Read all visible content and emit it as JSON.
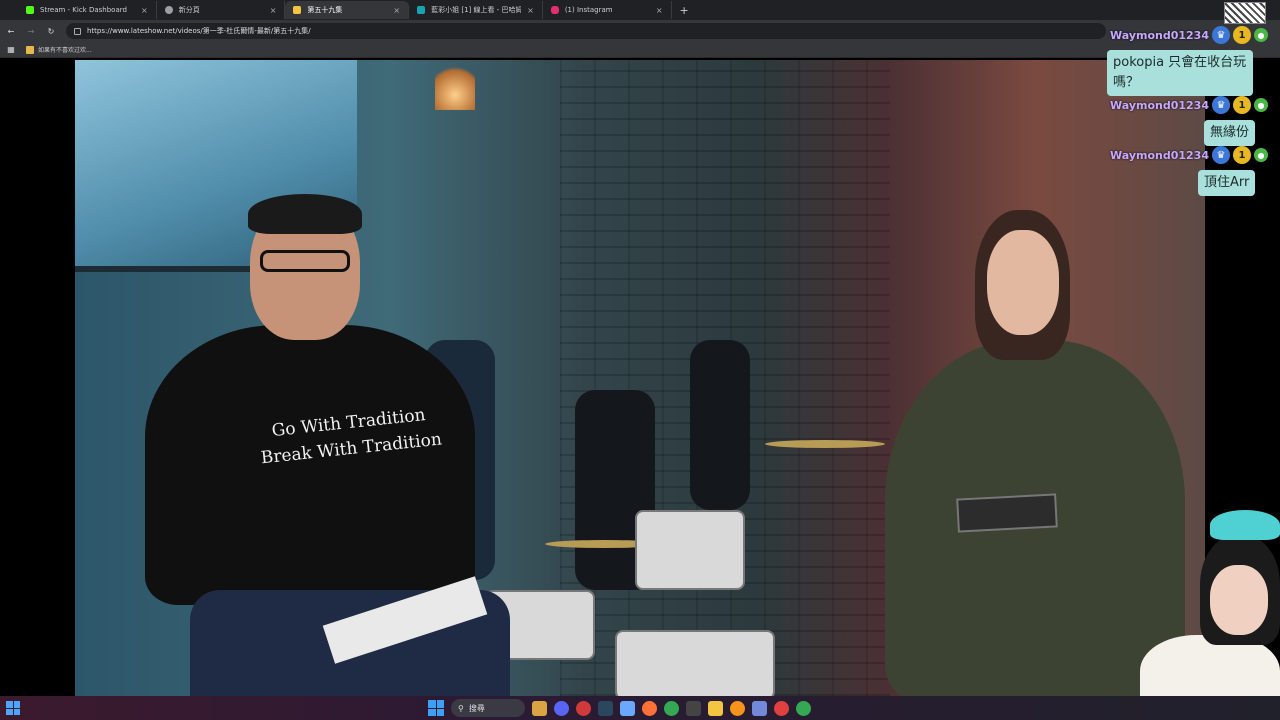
{
  "browser": {
    "tabs": [
      {
        "label": "Stream - Kick Dashboard",
        "favicon_color": "#53fc18",
        "active": false
      },
      {
        "label": "新分頁",
        "favicon_color": "#9aa0a6",
        "active": false
      },
      {
        "label": "第五十九集",
        "favicon_color": "#f5c542",
        "active": true
      },
      {
        "label": "藍彩小姐 [1] 線上看 - 巴哈姆特",
        "favicon_color": "#18a3b3",
        "active": false
      },
      {
        "label": "(1) Instagram",
        "favicon_color": "#e1306c",
        "active": false
      }
    ],
    "new_tab_symbol": "+",
    "close_symbol": "×",
    "url": "https://www.lateshow.net/videos/第一季-杜氏爾情-最新/第五十九集/",
    "bookmark_label": "如果有不喜欢过欢..."
  },
  "video": {
    "shirt_line1": "Go With Tradition",
    "shirt_line2": "Break With Tradition"
  },
  "chat": {
    "messages": [
      {
        "user": "Waymond01234",
        "text": "pokopia 只會在收台玩嗎？",
        "sub_months": "1"
      },
      {
        "user": "Waymond01234",
        "text": "無緣份",
        "sub_months": "1"
      },
      {
        "user": "Waymond01234",
        "text": "頂住Arr",
        "sub_months": "1"
      }
    ]
  },
  "taskbar": {
    "search_label": "搜尋",
    "pinned_icons": [
      "game-icon",
      "chat-icon",
      "security-icon",
      "steam-icon",
      "photos-icon",
      "firefox-icon",
      "chrome-icon",
      "terminal-icon",
      "folder-icon",
      "bitcoin-icon",
      "discord-icon",
      "record-icon",
      "chrome-icon"
    ],
    "icon_colors": {
      "game-icon": "#d9a441",
      "chat-icon": "#5865f2",
      "security-icon": "#d03a3a",
      "steam-icon": "#2a475e",
      "photos-icon": "#6aa8ff",
      "firefox-icon": "#ff7139",
      "chrome-icon": "#34a853",
      "terminal-icon": "#444444",
      "folder-icon": "#f4c542",
      "bitcoin-icon": "#f7931a",
      "discord-icon": "#7289da",
      "record-icon": "#e04040"
    }
  }
}
